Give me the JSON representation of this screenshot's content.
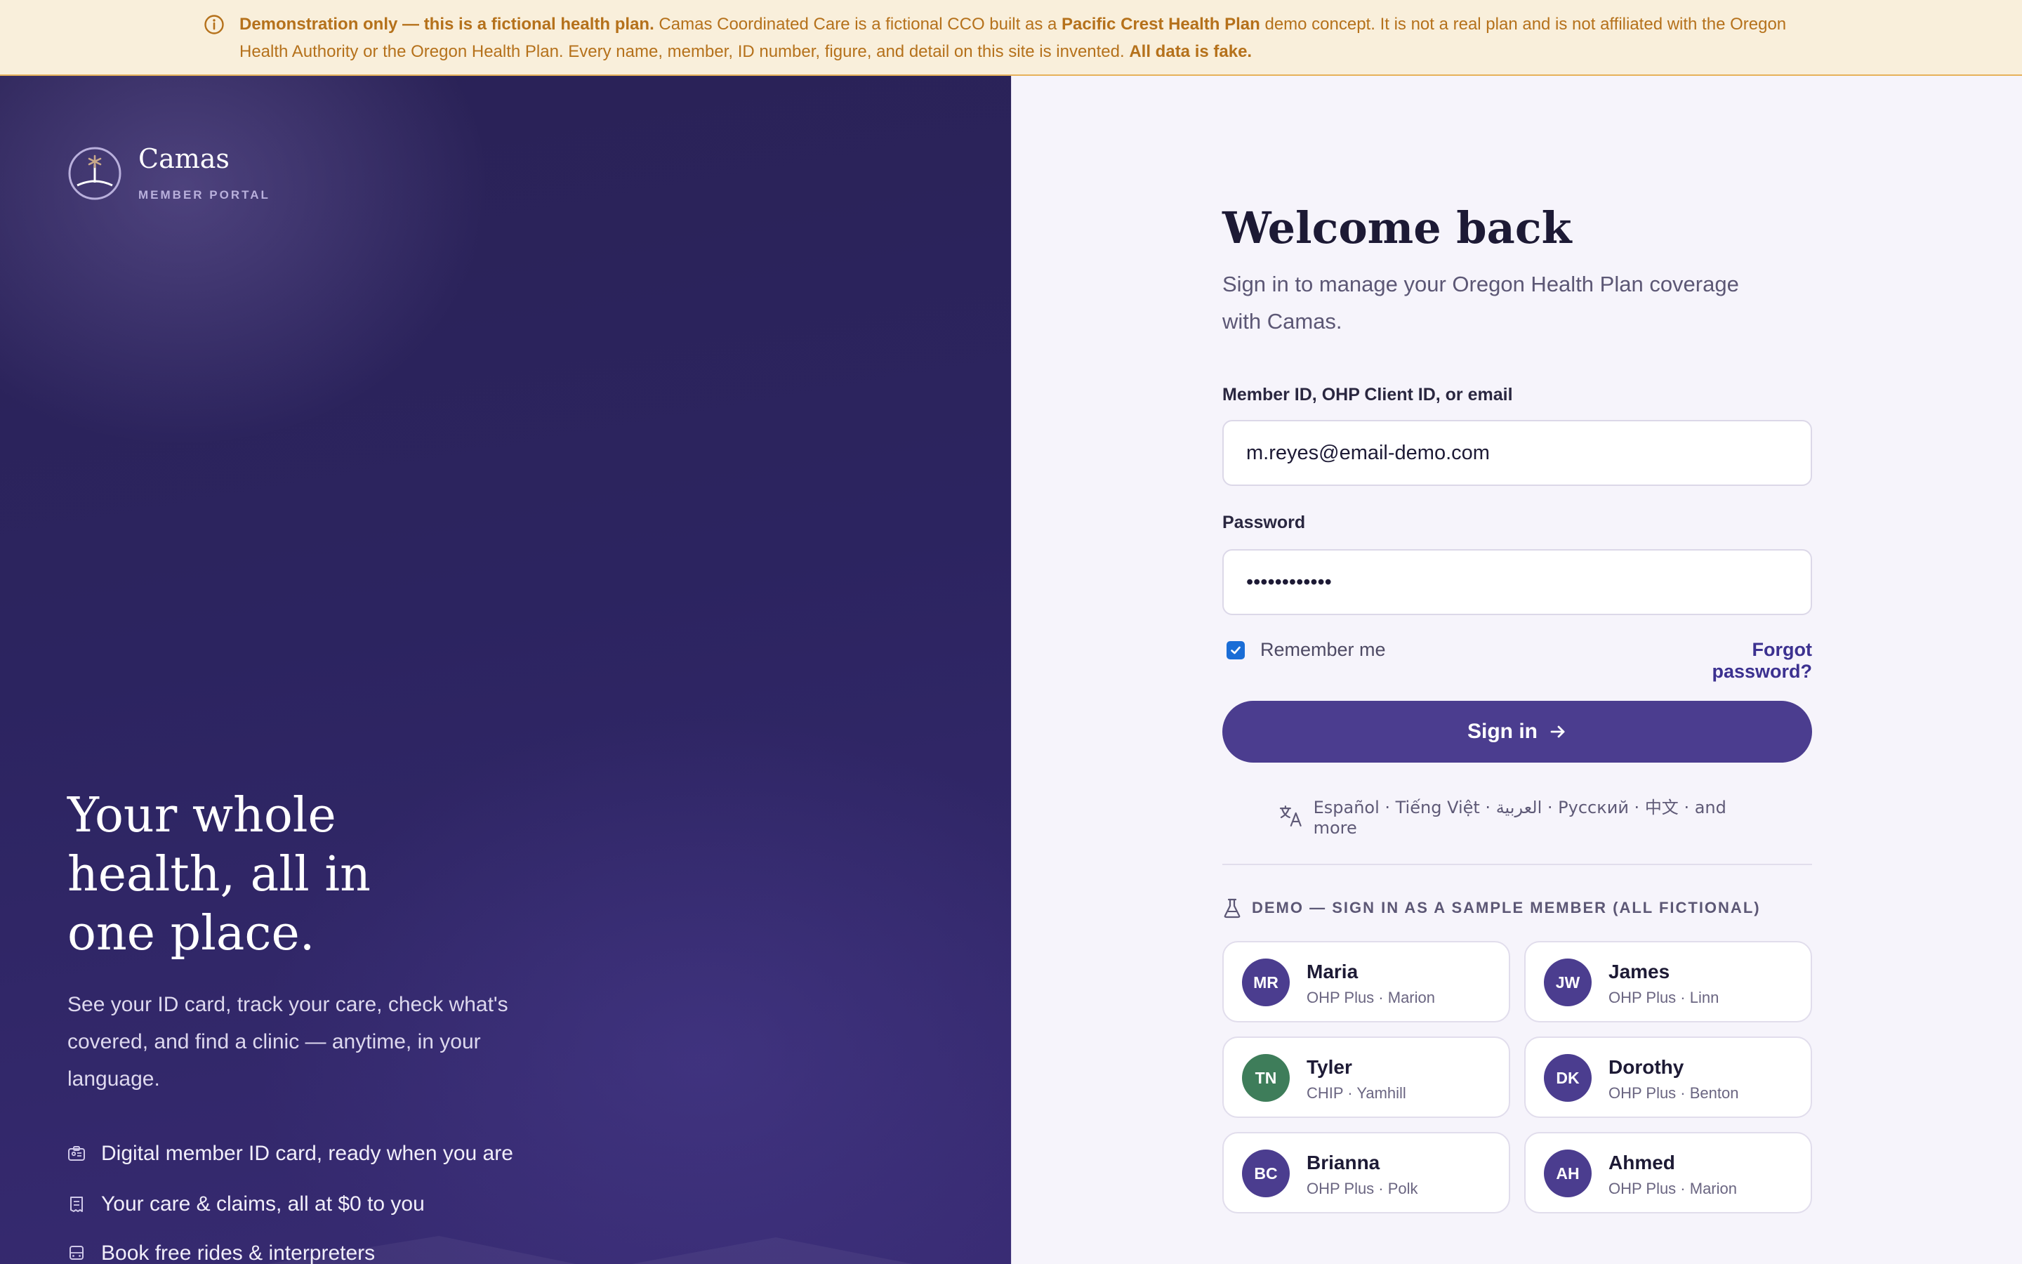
{
  "banner": {
    "bold_lead": "Demonstration only — this is a fictional health plan.",
    "text_a": " Camas Coordinated Care is a fictional CCO built as a ",
    "bold_plan": "Pacific Crest Health Plan",
    "text_b": " demo concept. It is not a real plan and is not affiliated with the Oregon Health Authority or the Oregon Health Plan. Every name, member, ID number, figure, and detail on this site is invented. ",
    "bold_tail": "All data is fake.",
    "icon": "info-icon"
  },
  "brand": {
    "name": "Camas",
    "subtitle": "MEMBER PORTAL"
  },
  "hero": {
    "title": "Your whole health, all in one place.",
    "description": "See your ID card, track your care, check what's covered, and find a clinic — anytime, in your language.",
    "features": [
      {
        "icon": "id-card-icon",
        "label": "Digital member ID card, ready when you are"
      },
      {
        "icon": "receipt-icon",
        "label": "Your care & claims, all at $0 to you"
      },
      {
        "icon": "bus-icon",
        "label": "Book free rides & interpreters"
      }
    ]
  },
  "login": {
    "title": "Welcome back",
    "subtitle": "Sign in to manage your Oregon Health Plan coverage with Camas.",
    "id_label": "Member ID, OHP Client ID, or email",
    "id_value": "m.reyes@email-demo.com",
    "password_label": "Password",
    "password_value": "demopassword",
    "remember_label": "Remember me",
    "remember_checked": true,
    "forgot_label": "Forgot password?",
    "signin_label": "Sign in",
    "languages": "Español · Tiếng Việt · العربية · Русский · 中文 · and more"
  },
  "demo": {
    "heading": "DEMO — SIGN IN AS A SAMPLE MEMBER (ALL FICTIONAL)",
    "members": [
      {
        "initials": "MR",
        "name": "Maria",
        "meta": "OHP Plus · Marion",
        "color": "#4b3d8f"
      },
      {
        "initials": "JW",
        "name": "James",
        "meta": "OHP Plus · Linn",
        "color": "#4b3d8f"
      },
      {
        "initials": "TN",
        "name": "Tyler",
        "meta": "CHIP · Yamhill",
        "color": "#3e7d5a"
      },
      {
        "initials": "DK",
        "name": "Dorothy",
        "meta": "OHP Plus · Benton",
        "color": "#4b3d8f"
      },
      {
        "initials": "BC",
        "name": "Brianna",
        "meta": "OHP Plus · Polk",
        "color": "#4b3d8f"
      },
      {
        "initials": "AH",
        "name": "Ahmed",
        "meta": "OHP Plus · Marion",
        "color": "#4b3d8f"
      }
    ]
  },
  "colors": {
    "primary": "#4b3d8f",
    "banner_bg": "#f9efdb",
    "banner_text": "#b5711b",
    "hero_bg": "#2c2460"
  }
}
